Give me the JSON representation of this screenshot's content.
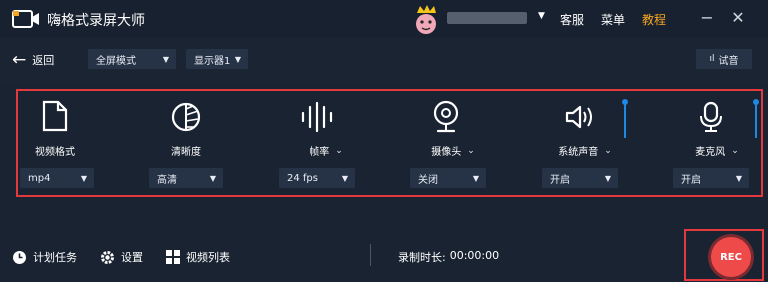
{
  "app": {
    "title": "嗨格式录屏大师"
  },
  "topbar": {
    "service": "客服",
    "menu": "菜单",
    "tutorial": "教程",
    "minimize": "−",
    "close": "✕"
  },
  "toolbar": {
    "back": "返回",
    "mode": "全屏模式",
    "display": "显示器1",
    "test_audio": "试音"
  },
  "columns": {
    "format": {
      "label": "视频格式",
      "value": "mp4"
    },
    "quality": {
      "label": "清晰度",
      "value": "高清"
    },
    "fps": {
      "label": "帧率",
      "value": "24 fps"
    },
    "camera": {
      "label": "摄像头",
      "value": "关闭"
    },
    "system_audio": {
      "label": "系统声音",
      "value": "开启",
      "volume": 1.0
    },
    "mic": {
      "label": "麦克风",
      "value": "开启",
      "volume": 1.0
    }
  },
  "bottom": {
    "schedule": "计划任务",
    "settings": "设置",
    "video_list": "视频列表",
    "rec_label": "录制时长:",
    "rec_time": "00:00:00",
    "rec_button": "REC"
  },
  "colors": {
    "background": "#1a2332",
    "accent_red": "#e2383e",
    "rec_red": "#ef4a4a",
    "volume_blue": "#1e88e5",
    "tutorial_orange": "#f5a623"
  },
  "icons": [
    "camera-logo-icon",
    "file-icon",
    "clarity-icon",
    "waveform-icon",
    "webcam-icon",
    "speaker-icon",
    "microphone-icon",
    "clock-icon",
    "gear-icon",
    "grid-icon"
  ]
}
